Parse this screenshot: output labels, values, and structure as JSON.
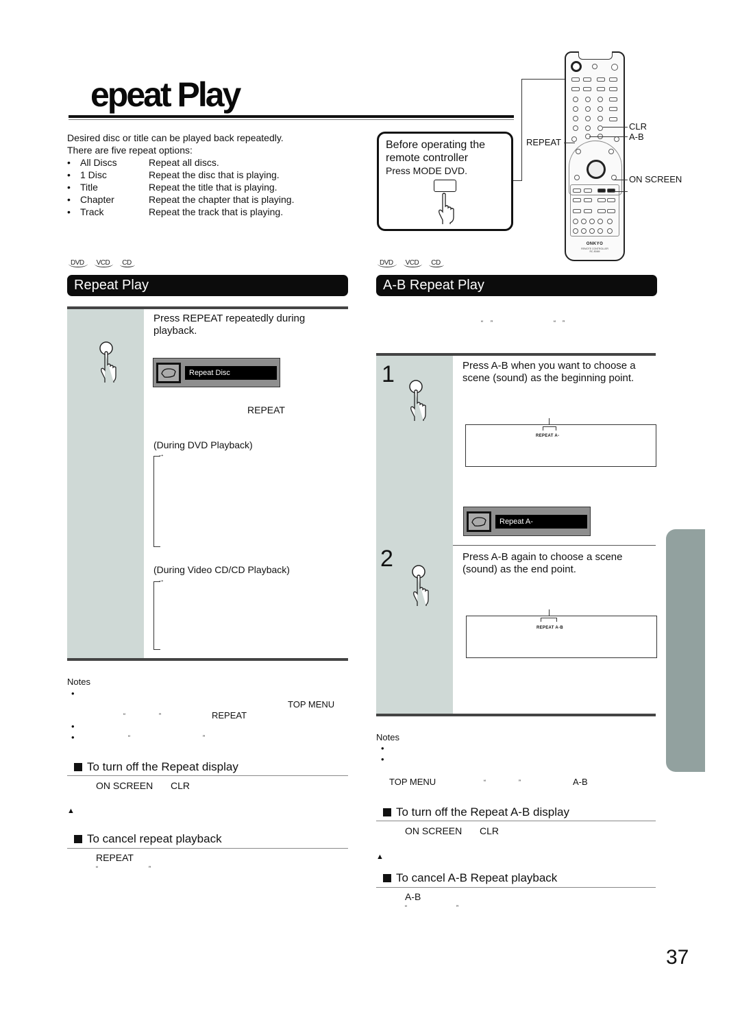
{
  "header": {
    "title": "epeat Play"
  },
  "intro": {
    "line1": "Desired disc or title can be played back repeatedly.",
    "line2": "There are five repeat options:",
    "options": [
      {
        "bullet": "•",
        "name": "All Discs",
        "desc": "Repeat all discs."
      },
      {
        "bullet": "•",
        "name": "1 Disc",
        "desc": "Repeat the disc that is playing."
      },
      {
        "bullet": "•",
        "name": "Title",
        "desc": "Repeat the title that is playing."
      },
      {
        "bullet": "•",
        "name": "Chapter",
        "desc": "Repeat the chapter that is playing."
      },
      {
        "bullet": "•",
        "name": "Track",
        "desc": "Repeat the track that is playing."
      }
    ]
  },
  "before_box": {
    "title_line1": "Before operating the",
    "title_line2": "remote controller",
    "instruction": "Press MODE DVD."
  },
  "remote": {
    "brand": "ONKYO",
    "model_line1": "REMOTE CONTROLLER",
    "model_line2": "RC-504M",
    "callouts": {
      "repeat": "REPEAT",
      "clr": "CLR",
      "ab": "A-B",
      "on_screen": "ON SCREEN"
    }
  },
  "disc_types": [
    "DVD",
    "VCD",
    "CD"
  ],
  "repeat_play": {
    "header": "Repeat Play",
    "step_instruction": "Press REPEAT repeatedly during playback.",
    "osd_text": "Repeat Disc",
    "key_ref": "REPEAT",
    "dvd_label": "(During DVD Playback)",
    "vcd_label": "(During Video CD/CD Playback)",
    "notes_title": "Notes",
    "notes_bullets": [
      "•",
      "•",
      "•"
    ],
    "notes_keys": {
      "top_menu": "TOP MENU",
      "open_quote": "“",
      "close_quote": "”",
      "repeat": "REPEAT"
    },
    "turn_off": {
      "title": "To turn off the Repeat display",
      "key1": "ON SCREEN",
      "key2": "CLR",
      "marker": "▲"
    },
    "cancel": {
      "title": "To cancel repeat playback",
      "key": "REPEAT",
      "open_quote": "“",
      "close_quote": "”"
    }
  },
  "ab_repeat": {
    "header": "A-B Repeat Play",
    "intro_quotes": [
      "“",
      "”",
      "“",
      "”"
    ],
    "steps": [
      {
        "number": "1",
        "instruction": "Press A-B when you want to choose a scene (sound) as the beginning point.",
        "display_label": "REPEAT A-",
        "osd_text": "Repeat A-"
      },
      {
        "number": "2",
        "instruction": "Press A-B again to choose a scene (sound) as the end point.",
        "display_label": "REPEAT A-B"
      }
    ],
    "notes_title": "Notes",
    "notes_bullets": [
      "•",
      "•"
    ],
    "notes_keys": {
      "top_menu": "TOP MENU",
      "open_quote": "“",
      "close_quote": "”",
      "ab": "A-B"
    },
    "turn_off": {
      "title": "To turn off the Repeat A-B display",
      "key1": "ON SCREEN",
      "key2": "CLR",
      "marker": "▲"
    },
    "cancel": {
      "title": "To cancel A-B Repeat playback",
      "key": "A-B",
      "open_quote": "“",
      "close_quote": "”"
    }
  },
  "footer": {
    "page_number": "37"
  }
}
